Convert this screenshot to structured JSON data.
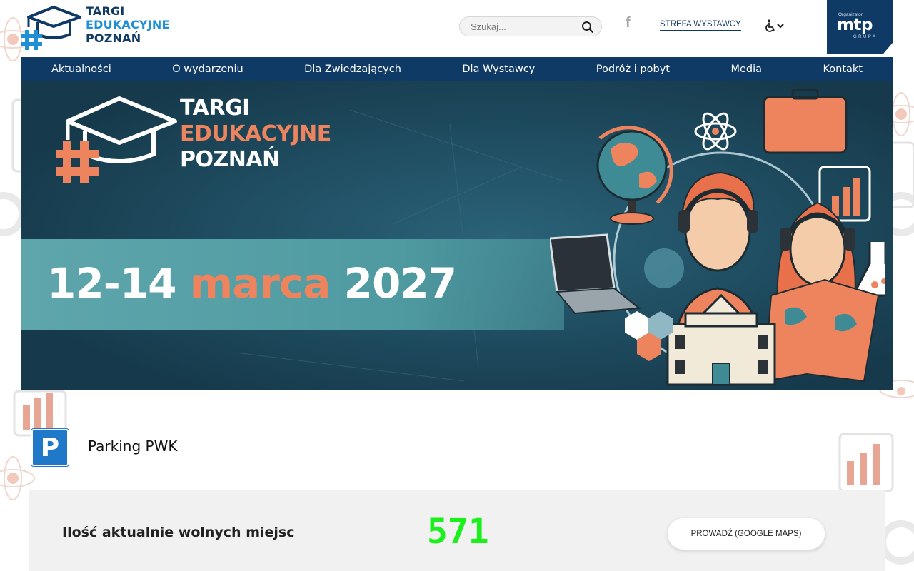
{
  "header": {
    "logo": {
      "line1": "TARGI",
      "line2": "EDUKACYJNE",
      "line3": "POZNAŃ"
    },
    "search": {
      "placeholder": "Szukaj...",
      "icon": "search-icon"
    },
    "facebook": {
      "icon": "facebook-icon",
      "glyph": "f"
    },
    "exhibitor_zone_label": "STREFA WYSTAWCY",
    "accessibility": {
      "icon": "wheelchair-icon"
    },
    "organizer": {
      "small": "Organizator",
      "big": "mtp",
      "group": "GRUPA"
    }
  },
  "nav": {
    "items": [
      {
        "label": "Aktualności"
      },
      {
        "label": "O wydarzeniu"
      },
      {
        "label": "Dla Zwiedzających"
      },
      {
        "label": "Dla Wystawcy"
      },
      {
        "label": "Podróż i pobyt"
      },
      {
        "label": "Media"
      },
      {
        "label": "Kontakt"
      }
    ]
  },
  "banner": {
    "title_line1": "TARGI",
    "title_line2": "EDUKACYJNE",
    "title_line3": "POZNAŃ",
    "date_days": "12-14",
    "date_month": "marca",
    "date_year": "2027"
  },
  "parking": {
    "sign": "P",
    "title": "Parking PWK",
    "free_spots_label": "Ilość aktualnie wolnych miejsc",
    "free_spots_count": "571",
    "navigate_button": "PROWADŹ (GOOGLE MAPS)"
  },
  "colors": {
    "navy": "#0f3a66",
    "accent_orange": "#ee845d",
    "banner_teal": "#5ea6ac",
    "counter_green": "#1cf01c",
    "parking_blue": "#1f78c8"
  }
}
